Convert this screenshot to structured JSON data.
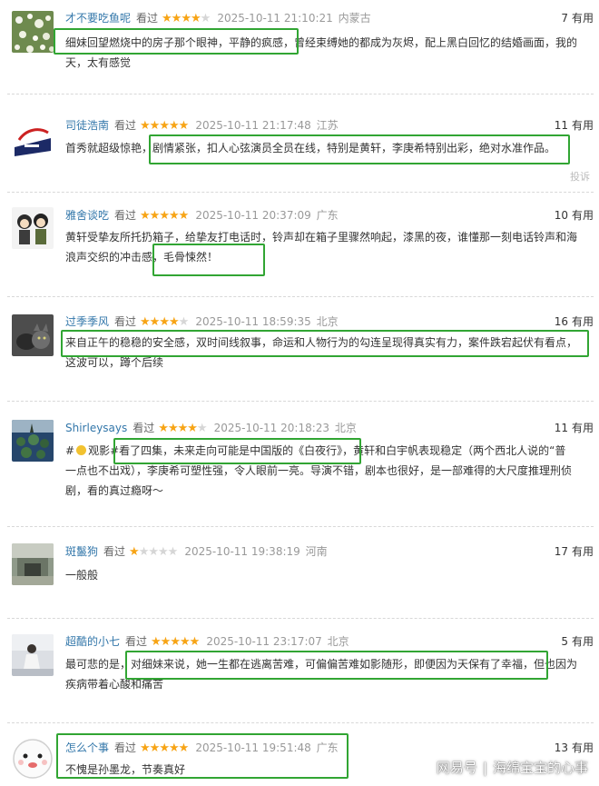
{
  "reviews": [
    {
      "user": "才不要吃鱼呢",
      "status": "看过",
      "rating": 4,
      "time": "2025-10-11 21:10:21",
      "location": "内蒙古",
      "useful_count": "7",
      "useful_label": "有用",
      "lines": [
        "细妹回望燃烧中的房子那个眼神，平静的疯感，曾经束缚她的都成为灰烬，配上黑白回忆的结婚画面，我的",
        "天，太有感觉"
      ]
    },
    {
      "user": "司徒浩南",
      "status": "看过",
      "rating": 5,
      "time": "2025-10-11 21:17:48",
      "location": "江苏",
      "useful_count": "11",
      "useful_label": "有用",
      "report_label": "投诉",
      "lines": [
        "首秀就超级惊艳，剧情紧张，扣人心弦演员全员在线，特别是黄轩，李庚希特别出彩，绝对水准作品。"
      ]
    },
    {
      "user": "雅舍谈吃",
      "status": "看过",
      "rating": 5,
      "time": "2025-10-11 20:37:09",
      "location": "广东",
      "useful_count": "10",
      "useful_label": "有用",
      "lines": [
        "黄轩受挚友所托扔箱子，给挚友打电话时，铃声却在箱子里骤然响起，漆黑的夜，谁懂那一刻电话铃声和海",
        "浪声交织的冲击感，毛骨悚然！"
      ]
    },
    {
      "user": "过季季风",
      "status": "看过",
      "rating": 4,
      "time": "2025-10-11 18:59:35",
      "location": "北京",
      "useful_count": "16",
      "useful_label": "有用",
      "lines": [
        "来自正午的稳稳的安全感，双时间线叙事，命运和人物行为的勾连呈现得真实有力，案件跌宕起伏有看点，",
        "这波可以，蹲个后续"
      ]
    },
    {
      "user": "Shirleysays",
      "status": "看过",
      "rating": 4,
      "time": "2025-10-11 20:18:23",
      "location": "北京",
      "useful_count": "11",
      "useful_label": "有用",
      "line1_prefix": "#",
      "line1_rest": "观影#看了四集，未来走向可能是中国版的《白夜行》，黄轩和白宇帆表现稳定（两个西北人说的“普",
      "lines": [
        "一点也不出戏），李庚希可塑性强，令人眼前一亮。导演不错，剧本也很好，是一部难得的大尺度推理刑侦",
        "剧，看的真过瘾呀～"
      ]
    },
    {
      "user": "斑鬣狗",
      "status": "看过",
      "rating": 1,
      "time": "2025-10-11 19:38:19",
      "location": "河南",
      "useful_count": "17",
      "useful_label": "有用",
      "lines": [
        "一般般"
      ]
    },
    {
      "user": "超酷的小七",
      "status": "看过",
      "rating": 5,
      "time": "2025-10-11 23:17:07",
      "location": "北京",
      "useful_count": "5",
      "useful_label": "有用",
      "lines": [
        "最可悲的是，对细妹来说，她一生都在逃离苦难，可偏偏苦难如影随形，即便因为天保有了幸福，但也因为",
        "疾病带着心酸和痛苦"
      ]
    },
    {
      "user": "怎么个事",
      "status": "看过",
      "rating": 5,
      "time": "2025-10-11 19:51:48",
      "location": "广东",
      "useful_count": "13",
      "useful_label": "有用",
      "lines": [
        "不愧是孙墨龙，节奏真好"
      ]
    }
  ],
  "watermark": {
    "brand": "网易号",
    "author": "海绵宝宝的心事"
  },
  "colors": {
    "username": "#3377aa",
    "star_on": "#f7a415",
    "star_off": "#d6d6d6",
    "highlight_box": "#31a533",
    "meta_gray": "#999999"
  }
}
